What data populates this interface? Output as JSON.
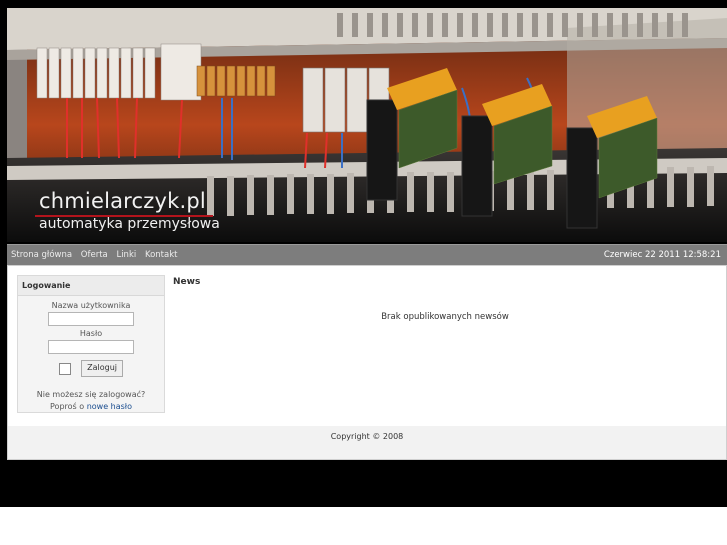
{
  "header": {
    "title": "chmielarczyk.pl",
    "subtitle": "automatyka przemysłowa"
  },
  "nav": {
    "items": [
      {
        "label": "Strona główna"
      },
      {
        "label": "Oferta"
      },
      {
        "label": "Linki"
      },
      {
        "label": "Kontakt"
      }
    ],
    "datetime": "Czerwiec 22 2011 12:58:21"
  },
  "login": {
    "heading": "Logowanie",
    "username_label": "Nazwa użytkownika",
    "username_value": "",
    "password_label": "Hasło",
    "password_value": "",
    "remember_checked": false,
    "submit_label": "Zaloguj",
    "help_line": "Nie możesz się zalogować?",
    "help_prefix": "Poproś o",
    "help_link": "nowe hasło"
  },
  "news": {
    "heading": "News",
    "empty_message": "Brak opublikowanych newsów"
  },
  "footer": {
    "copyright": "Copyright © 2008"
  },
  "colors": {
    "banner_panel": "#d9d4cc",
    "banner_wires": "#c0401c",
    "navbar": "#7d7d7d",
    "title_underline": "#b3141c",
    "link": "#1a4d8f"
  }
}
